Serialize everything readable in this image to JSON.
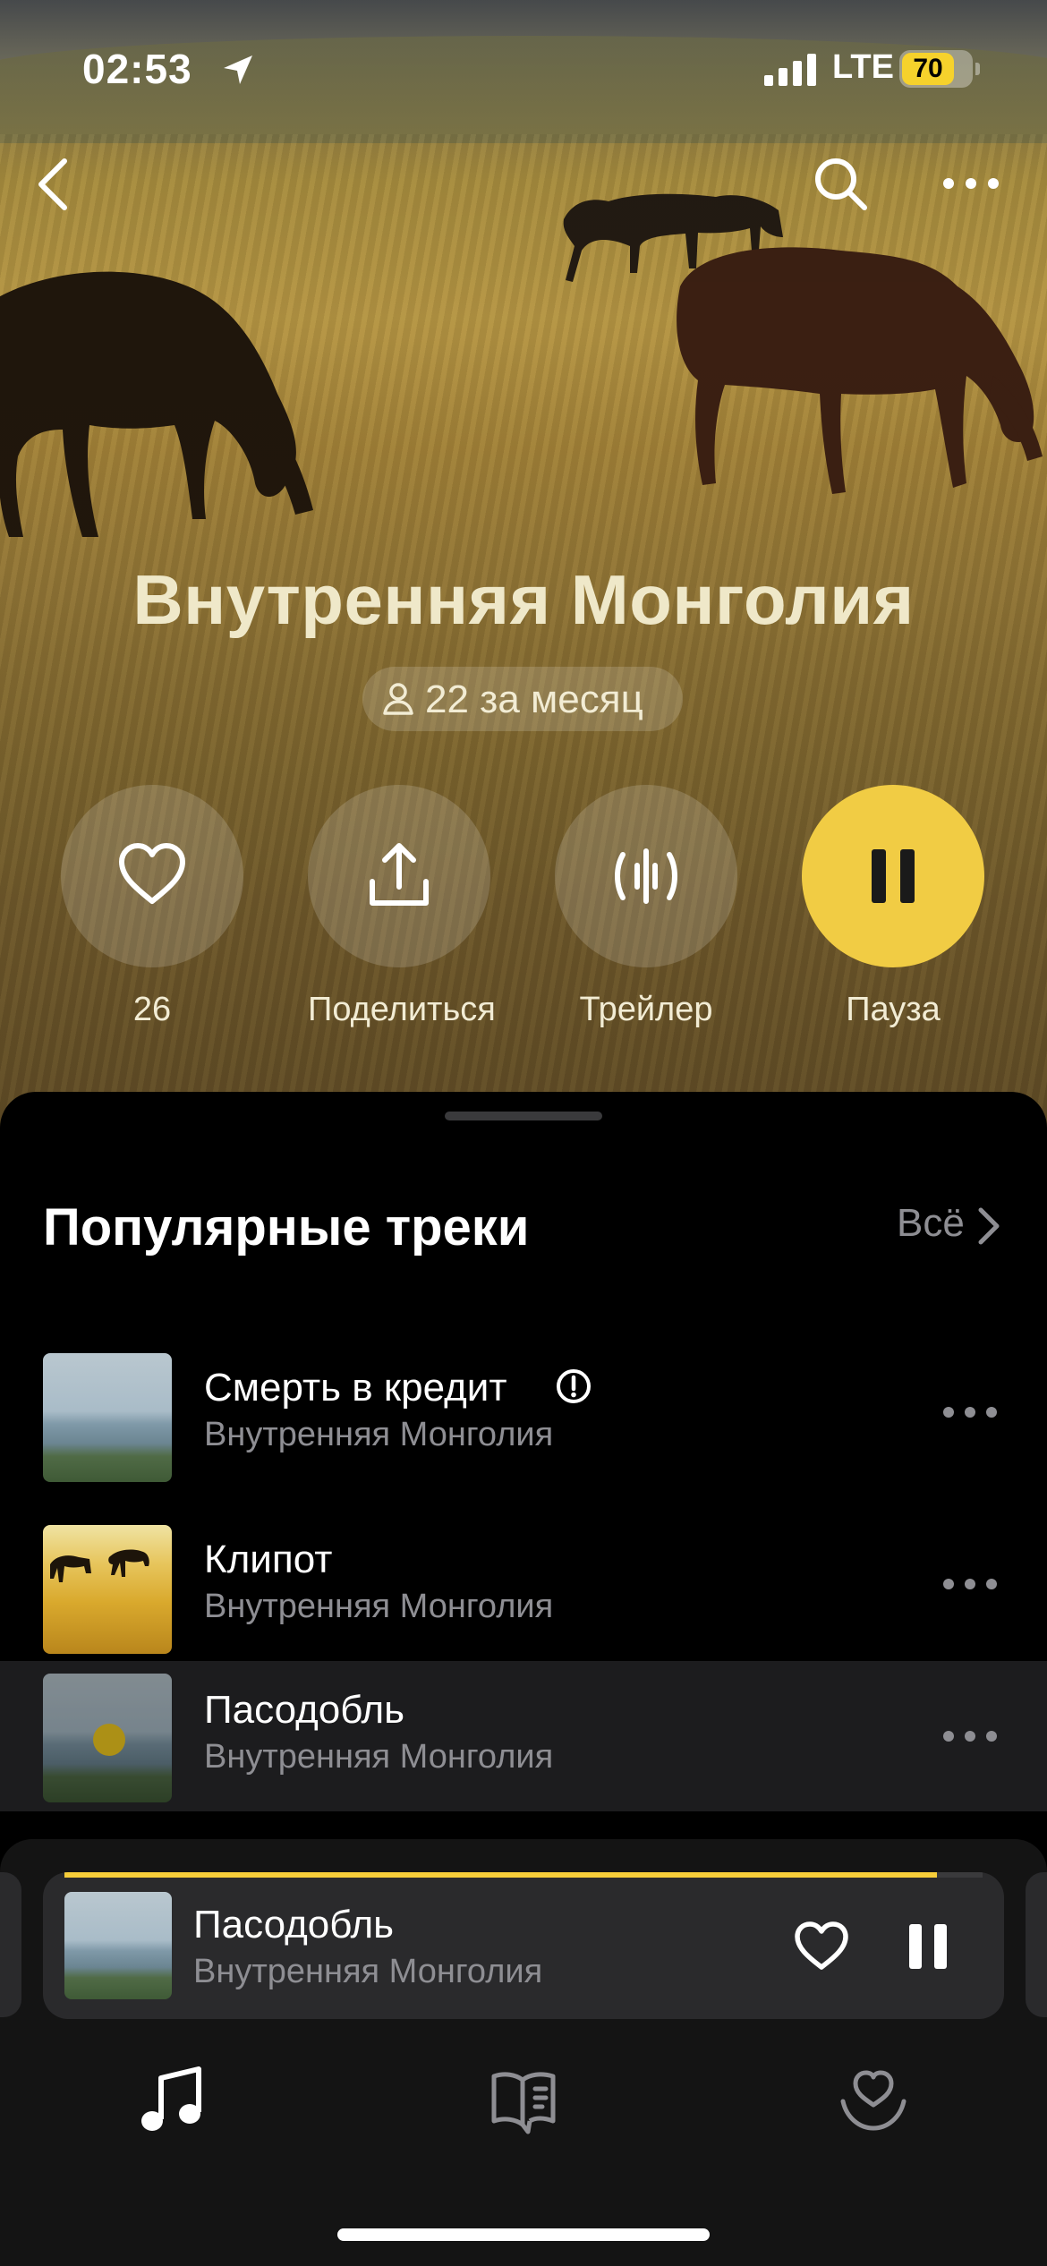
{
  "status_bar": {
    "time": "02:53",
    "network": "LTE",
    "battery": "70"
  },
  "artist": {
    "name": "Внутренняя Монголия",
    "listeners": "22 за месяц"
  },
  "actions": [
    {
      "id": "like",
      "label": "26",
      "icon": "heart-icon"
    },
    {
      "id": "share",
      "label": "Поделиться",
      "icon": "share-icon"
    },
    {
      "id": "trailer",
      "label": "Трейлер",
      "icon": "waveform-icon"
    },
    {
      "id": "pause",
      "label": "Пауза",
      "icon": "pause-icon"
    }
  ],
  "popular": {
    "title": "Популярные треки",
    "see_all": "Всё",
    "tracks": [
      {
        "title": "Смерть в кредит",
        "artist": "Внутренняя Монголия",
        "explicit": true,
        "active": false
      },
      {
        "title": "Клипот",
        "artist": "Внутренняя Монголия",
        "explicit": false,
        "active": false
      },
      {
        "title": "Пасодобль",
        "artist": "Внутренняя Монголия",
        "explicit": false,
        "active": true
      }
    ]
  },
  "mini_player": {
    "title": "Пасодобль",
    "artist": "Внутренняя Монголия",
    "progress": 0.95
  },
  "tabs": [
    {
      "id": "music",
      "icon": "music-note-icon",
      "active": true
    },
    {
      "id": "books",
      "icon": "book-icon",
      "active": false
    },
    {
      "id": "collection",
      "icon": "heart-hand-icon",
      "active": false
    }
  ],
  "colors": {
    "accent": "#f1cc44",
    "secondary_text": "#8e8e93",
    "progress": "#f6cd3a"
  }
}
